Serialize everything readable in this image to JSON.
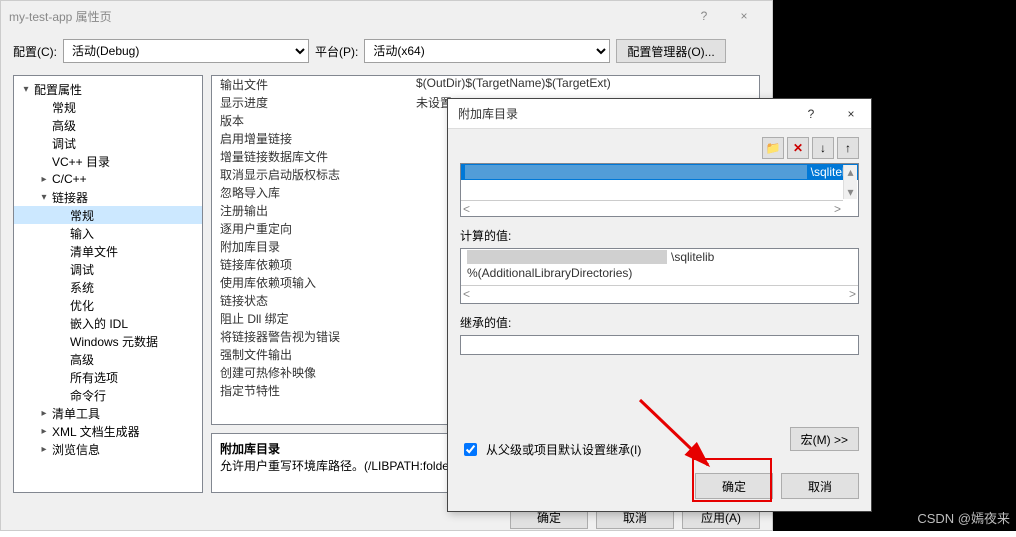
{
  "window": {
    "title": "my-test-app 属性页",
    "help_icon": "?",
    "close_icon": "×"
  },
  "config_bar": {
    "config_label": "配置(C):",
    "config_value": "活动(Debug)",
    "platform_label": "平台(P):",
    "platform_value": "活动(x64)",
    "manager_btn": "配置管理器(O)..."
  },
  "tree": [
    {
      "label": "配置属性",
      "depth": 0,
      "expand": "▾"
    },
    {
      "label": "常规",
      "depth": 1,
      "expand": ""
    },
    {
      "label": "高级",
      "depth": 1,
      "expand": ""
    },
    {
      "label": "调试",
      "depth": 1,
      "expand": ""
    },
    {
      "label": "VC++ 目录",
      "depth": 1,
      "expand": ""
    },
    {
      "label": "C/C++",
      "depth": 1,
      "expand": "▸"
    },
    {
      "label": "链接器",
      "depth": 1,
      "expand": "▾"
    },
    {
      "label": "常规",
      "depth": 2,
      "expand": "",
      "selected": true
    },
    {
      "label": "输入",
      "depth": 2,
      "expand": ""
    },
    {
      "label": "清单文件",
      "depth": 2,
      "expand": ""
    },
    {
      "label": "调试",
      "depth": 2,
      "expand": ""
    },
    {
      "label": "系统",
      "depth": 2,
      "expand": ""
    },
    {
      "label": "优化",
      "depth": 2,
      "expand": ""
    },
    {
      "label": "嵌入的 IDL",
      "depth": 2,
      "expand": ""
    },
    {
      "label": "Windows 元数据",
      "depth": 2,
      "expand": ""
    },
    {
      "label": "高级",
      "depth": 2,
      "expand": ""
    },
    {
      "label": "所有选项",
      "depth": 2,
      "expand": ""
    },
    {
      "label": "命令行",
      "depth": 2,
      "expand": ""
    },
    {
      "label": "清单工具",
      "depth": 1,
      "expand": "▸"
    },
    {
      "label": "XML 文档生成器",
      "depth": 1,
      "expand": "▸"
    },
    {
      "label": "浏览信息",
      "depth": 1,
      "expand": "▸"
    }
  ],
  "props": [
    {
      "k": "输出文件",
      "v": "$(OutDir)$(TargetName)$(TargetExt)"
    },
    {
      "k": "显示进度",
      "v": "未设置"
    },
    {
      "k": "版本",
      "v": ""
    },
    {
      "k": "启用增量链接",
      "v": ""
    },
    {
      "k": "增量链接数据库文件",
      "v": ""
    },
    {
      "k": "取消显示启动版权标志",
      "v": ""
    },
    {
      "k": "忽略导入库",
      "v": ""
    },
    {
      "k": "注册输出",
      "v": ""
    },
    {
      "k": "逐用户重定向",
      "v": ""
    },
    {
      "k": "附加库目录",
      "v": ""
    },
    {
      "k": "链接库依赖项",
      "v": ""
    },
    {
      "k": "使用库依赖项输入",
      "v": ""
    },
    {
      "k": "链接状态",
      "v": ""
    },
    {
      "k": "阻止 Dll 绑定",
      "v": ""
    },
    {
      "k": "将链接器警告视为错误",
      "v": ""
    },
    {
      "k": "强制文件输出",
      "v": ""
    },
    {
      "k": "创建可热修补映像",
      "v": ""
    },
    {
      "k": "指定节特性",
      "v": ""
    }
  ],
  "desc": {
    "title": "附加库目录",
    "text": "允许用户重写环境库路径。(/LIBPATH:folder)"
  },
  "main_btns": {
    "ok": "确定",
    "cancel": "取消",
    "apply": "应用(A)"
  },
  "sub": {
    "title": "附加库目录",
    "help_icon": "?",
    "close_icon": "×",
    "tool_new": "📁",
    "tool_del": "✕",
    "tool_up": "↓",
    "tool_down": "↑",
    "list_item_suffix": "\\sqlitelib",
    "evaluated_label": "计算的值:",
    "evaluated_line1_suffix": "\\sqlitelib",
    "evaluated_line2": "%(AdditionalLibraryDirectories)",
    "inherited_label": "继承的值:",
    "inherit_chk": "从父级或项目默认设置继承(I)",
    "macro_btn": "宏(M) >>",
    "ok": "确定",
    "cancel": "取消",
    "scroll_left": "<",
    "scroll_right": ">",
    "vsb_up": "▴",
    "vsb_down": "▾"
  },
  "watermark": "CSDN @嫣夜来"
}
